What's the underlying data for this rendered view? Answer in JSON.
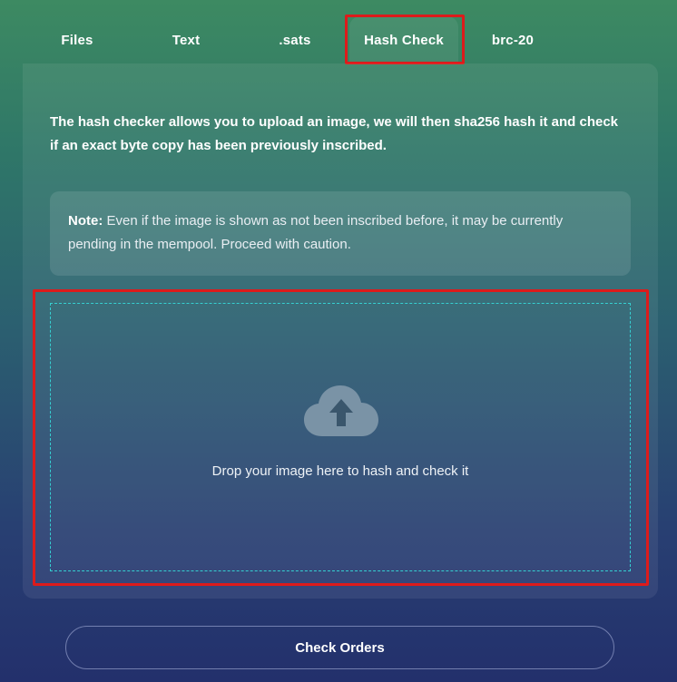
{
  "tabs": [
    {
      "label": "Files"
    },
    {
      "label": "Text"
    },
    {
      "label": ".sats"
    },
    {
      "label": "Hash Check",
      "active": true
    },
    {
      "label": "brc-20"
    }
  ],
  "panel": {
    "intro": "The hash checker allows you to upload an image, we will then sha256 hash it and check if an exact byte copy has been previously inscribed.",
    "note_label": "Note:",
    "note_text": " Even if the image is shown as not been inscribed before, it may be currently pending in the mempool. Proceed with caution."
  },
  "dropzone": {
    "text": "Drop your image here to hash and check it",
    "icon": "cloud-upload-icon"
  },
  "check_orders_label": "Check Orders",
  "colors": {
    "highlight": "#dd1b1b",
    "dropzone_border": "#35d0d2",
    "icon": "#7a93a6"
  }
}
